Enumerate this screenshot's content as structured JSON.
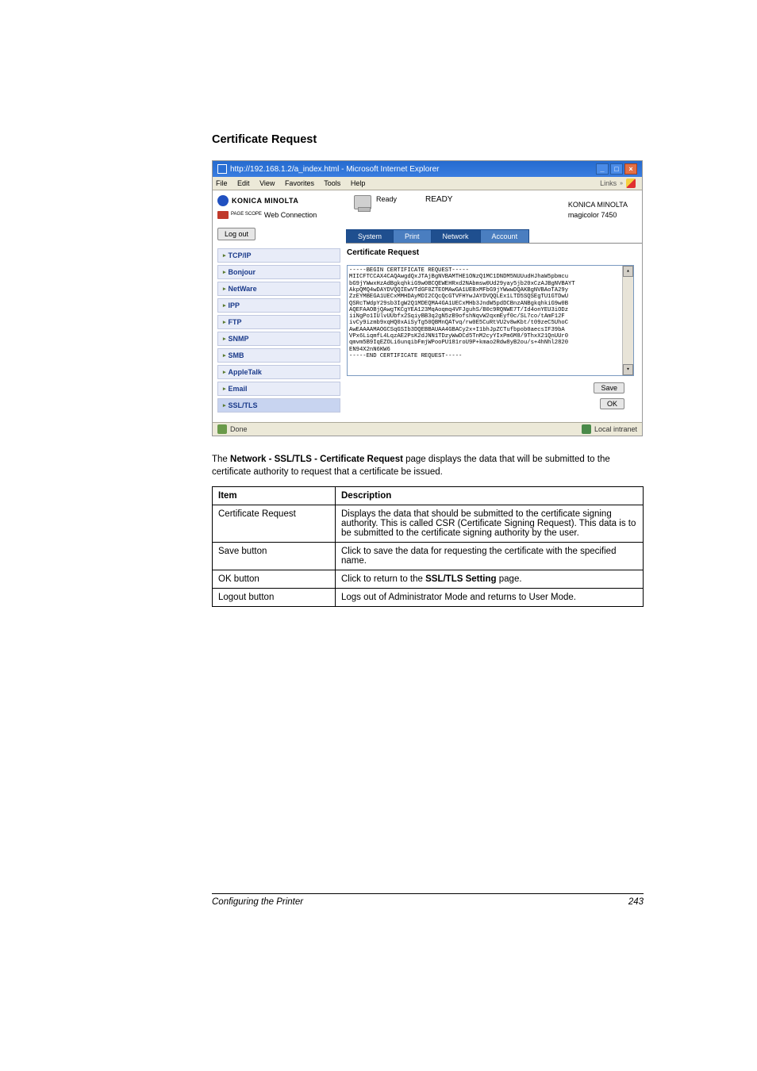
{
  "page_title": "Certificate Request",
  "screenshot": {
    "window_title": "http://192.168.1.2/a_index.html - Microsoft Internet Explorer",
    "menu": {
      "file": "File",
      "edit": "Edit",
      "view": "View",
      "favorites": "Favorites",
      "tools": "Tools",
      "help": "Help",
      "links": "Links"
    },
    "logo": {
      "brand": "KONICA MINOLTA",
      "webconn_prefix": "PAGE SCOPE",
      "webconn": "Web Connection"
    },
    "status": {
      "printer_state_small": "Ready",
      "printer_state_big": "READY"
    },
    "header_right": {
      "brand": "KONICA MINOLTA",
      "model": "magicolor 7450"
    },
    "logout": "Log out",
    "tabs": {
      "system": "System",
      "print": "Print",
      "network": "Network",
      "account": "Account"
    },
    "sidebar": [
      "TCP/IP",
      "Bonjour",
      "NetWare",
      "IPP",
      "FTP",
      "SNMP",
      "SMB",
      "AppleTalk",
      "Email",
      "SSL/TLS"
    ],
    "section_title": "Certificate Request",
    "cert_text": "-----BEGIN CERTIFICATE REQUEST-----\nMIICFTCCAX4CAQAwgdQxJTAjBgNVBAMTHE1ONzQ1MC1DNDM5NUUudHJhaW5pbmcu\nbG9jYWwxHzAdBgkqhkiG9w0BCQEWEHRxd2NAbmsw0Ud29yay5jb20xCzAJBgNVBAYT\nAkpQMQ4wDAYDVQQIEwVTdGF0ZTEOMAwGA1UEBxMFbG9jYWwwDQAKBgNVBAoTA29y\nZzEYMBEGA1UECxMMHDAyMDI2CQcQcGTVFHYwJAYDVQQLEx1LTD5SQSEgTU1GTDwU\nQSRcTWdpY29sb3IgW2Q1MDEQMA4GA1UECxMHb3JndW5pdDCBnzANBgkqhkiG9w0B\nAQEFAAOBjQAwgTKCgYEA123MqAoqmq4VFJguhS/B0c9RQNWE7T/Id4onYEU3iODz\niiNgPo1IUlvUUbfx2SqiyBB3q2gN5zB9ofshNqvW2qxmEyf0c/SL7co/tAmF12F\nivCy9izmb9xqHQ0xAiSyTg50QBMnQATvq/rw0E5CuRtVU2v8wKbt/t09zeC5UhoC\nAwEAAAAMAOGCSqGSIb3DQEBBAUAA4GBACy2x+I1bhJpZCTufbpob0aecsIF39bA\nVPx6LiqmfL4LqzAE2PsK2dJNN1TDzyWwDCd5TnM2cyYIxPm6M8/9ThxX21QnUUr0\nqmvm5B9IqEZOLi6unqibFmjWPooPU181roU9P+kmao2Rdw8yB2ou/s+4hNhl2820\nEN94X2nN6KW6\n-----END CERTIFICATE REQUEST-----",
    "buttons": {
      "save": "Save",
      "ok": "OK"
    },
    "statusbar": {
      "done": "Done",
      "zone": "Local intranet"
    }
  },
  "body_text": {
    "p1_pre": "The ",
    "p1_bold": "Network - SSL/TLS - Certificate Request",
    "p1_post": " page displays the data that will be submitted to the certificate authority to request that a certificate be issued."
  },
  "table": {
    "head": {
      "c1": "Item",
      "c2": "Description"
    },
    "rows": [
      {
        "c1": "Certificate Request",
        "c2": "Displays the data that should be submitted to the certificate signing authority. This is called CSR (Certificate Signing Request). This data is to be submitted to the certificate signing authority by the user."
      },
      {
        "c1": "Save button",
        "c2": "Click to save the data for requesting the certificate with the specified name."
      },
      {
        "c1": "OK button",
        "c2_pre": "Click to return to the ",
        "c2_bold": "SSL/TLS Setting",
        "c2_post": " page."
      },
      {
        "c1": "Logout button",
        "c2": "Logs out of Administrator Mode and returns to User Mode."
      }
    ]
  },
  "footer": {
    "left": "Configuring the Printer",
    "right": "243"
  }
}
